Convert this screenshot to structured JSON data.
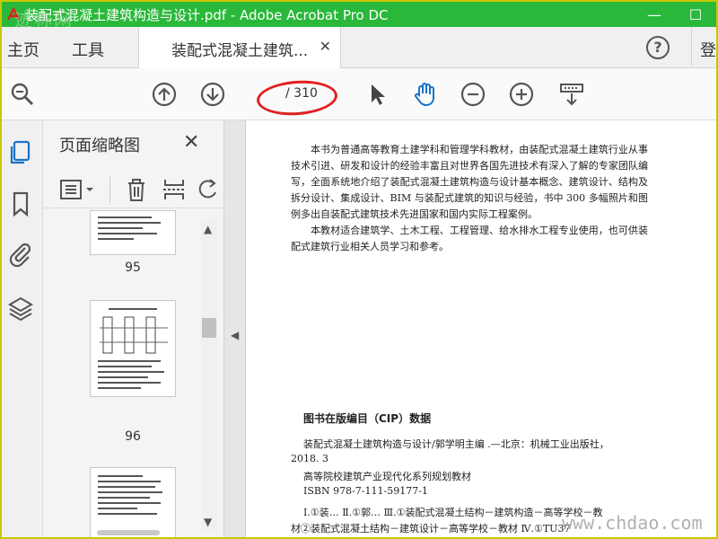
{
  "window": {
    "title": "装配式混凝土建筑构造与设计.pdf - Adobe Acrobat Pro DC",
    "watermark": "迹称网",
    "minimize": "—",
    "maximize": "☐"
  },
  "tabs": {
    "home": "主页",
    "tools": "工具",
    "document": "装配式混凝土建筑...",
    "close": "✕",
    "help": "?",
    "signin": "登"
  },
  "toolbar": {
    "current_page": "",
    "total_pages": "/ 310"
  },
  "thumbnails_panel": {
    "title": "页面缩略图",
    "close": "✕",
    "pages": [
      "95",
      "96"
    ]
  },
  "document": {
    "paragraph1": "本书为普通高等教育土建学科和管理学科教材，由装配式混凝土建筑行业从事技术引进、研发和设计的经验丰富且对世界各国先进技术有深入了解的专家团队编写，全面系统地介绍了装配式混凝土建筑构造与设计基本概念、建筑设计、结构及拆分设计、集成设计、BIM 与装配式建筑的知识与经验，书中 300 多幅照片和图例多出自装配式建筑技术先进国家和国内实际工程案例。",
    "paragraph2": "本教材适合建筑学、土木工程、工程管理、给水排水工程专业使用，也可供装配式建筑行业相关人员学习和参考。",
    "cip_title": "图书在版编目（CIP）数据",
    "cip_line1": "装配式混凝土建筑构造与设计/郭学明主编 .—北京：机械工业出版社，",
    "cip_line2": "2018. 3",
    "cip_line3": "高等院校建筑产业现代化系列规划教材",
    "cip_line4": "ISBN 978-7-111-59177-1",
    "cip_line5": "Ⅰ.①装…   Ⅱ.①郭…   Ⅲ.①装配式混凝土结构－建筑构造－高等学校－教",
    "cip_line6": "材②装配式混凝土结构－建筑设计－高等学校－教材   Ⅳ.①TU37"
  },
  "site_watermark": "www.chdao.com",
  "colors": {
    "titlebar": "#2ab83a",
    "accent_blue": "#1a73c8",
    "annotation": "#e02020"
  }
}
